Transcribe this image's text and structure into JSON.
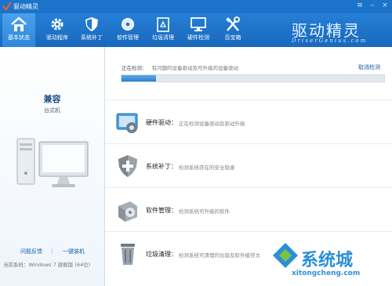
{
  "window": {
    "title": "驱动精灵"
  },
  "toolbar": {
    "items": [
      {
        "label": "基本状态",
        "icon": "home-icon"
      },
      {
        "label": "驱动程序",
        "icon": "gear-icon"
      },
      {
        "label": "系统补丁",
        "icon": "shield-icon"
      },
      {
        "label": "软件管理",
        "icon": "disc-icon"
      },
      {
        "label": "垃圾清理",
        "icon": "recycle-bin-icon"
      },
      {
        "label": "硬件检测",
        "icon": "monitor-icon"
      },
      {
        "label": "百宝箱",
        "icon": "tools-icon"
      }
    ],
    "brand": {
      "name": "驱动精灵",
      "url": "DriverGenius.com"
    }
  },
  "sidebar": {
    "status": "兼容",
    "machine_type": "台式机",
    "links": {
      "feedback": "问题反馈",
      "one_click": "一键装机"
    },
    "system_label": "当前系统：",
    "system_value": "Windows 7 旗舰版 (64位)"
  },
  "main": {
    "detect_label": "正在检测：",
    "detect_desc": "有问题的设备驱动及可升级的设备驱动",
    "cancel_label": "取消检测",
    "progress": 0.13,
    "rows": [
      {
        "name": "硬件驱动：",
        "desc": "正在检测设备驱动及驱动升级",
        "icon": "hardware-driver-icon"
      },
      {
        "name": "系统补丁：",
        "desc": "检测系统存在的安全隐患",
        "icon": "security-shield-icon"
      },
      {
        "name": "软件管理：",
        "desc": "检测系统可升级的软件",
        "icon": "software-disc-icon"
      },
      {
        "name": "垃圾清理：",
        "desc": "检测系统可清理的垃圾及软件缓存文",
        "icon": "trash-can-icon"
      }
    ]
  },
  "watermark": {
    "text": "系统城",
    "url": "xitongcheng.com"
  },
  "colors": {
    "accent": "#1b74c9",
    "link": "#1b5fa8",
    "progress": "#2d80d2"
  }
}
